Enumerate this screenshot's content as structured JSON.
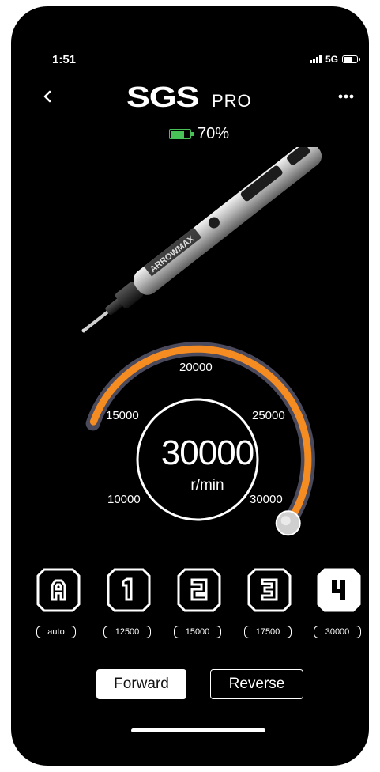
{
  "status_bar": {
    "time": "1:51",
    "network": "5G"
  },
  "header": {
    "logo_text": "SGS",
    "logo_suffix": "PRO"
  },
  "battery": {
    "percent_label": "70%",
    "level": 0.7,
    "color": "#48c257"
  },
  "device": {
    "brand_text": "ARROWMAX"
  },
  "gauge": {
    "value_label": "30000",
    "unit": "r/min",
    "ticks": [
      "10000",
      "15000",
      "20000",
      "25000",
      "30000"
    ],
    "min": 10000,
    "max": 30000,
    "value": 30000,
    "arc_color": "#f58c22",
    "track_color": "#4a4a5c"
  },
  "modes": [
    {
      "glyph": "A",
      "label": "auto",
      "selected": false
    },
    {
      "glyph": "1",
      "label": "12500",
      "selected": false
    },
    {
      "glyph": "2",
      "label": "15000",
      "selected": false
    },
    {
      "glyph": "3",
      "label": "17500",
      "selected": false
    },
    {
      "glyph": "4",
      "label": "30000",
      "selected": true
    }
  ],
  "direction": {
    "forward_label": "Forward",
    "reverse_label": "Reverse",
    "selected": "forward"
  }
}
